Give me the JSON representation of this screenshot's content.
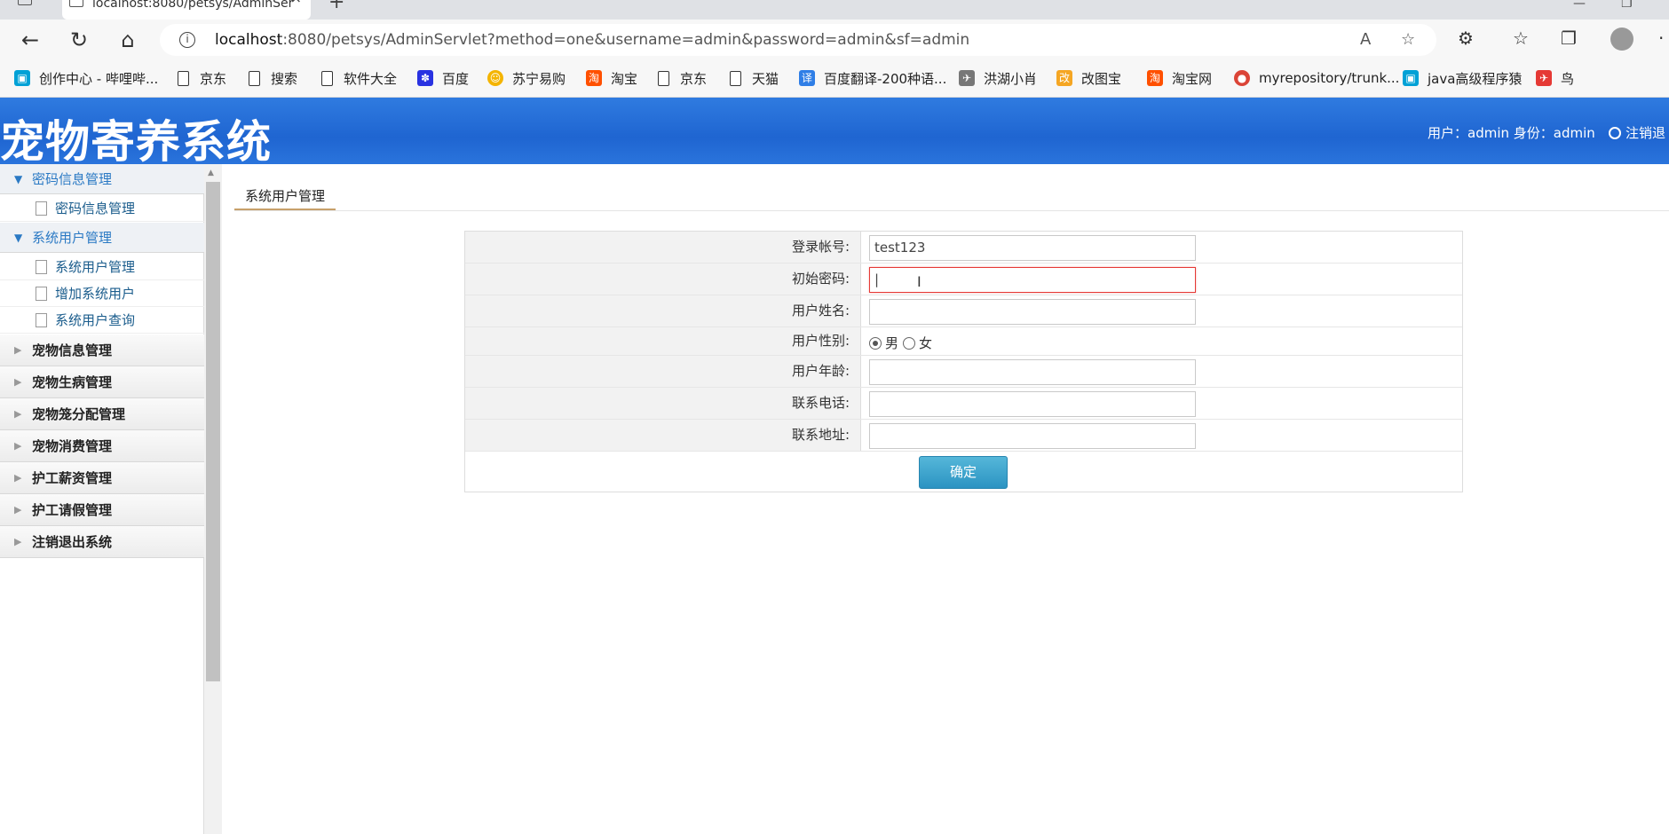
{
  "browser": {
    "tab_title": "localhost:8080/petsys/AdminSer",
    "url_host": "localhost",
    "url_rest": ":8080/petsys/AdminServlet?method=one&username=admin&password=admin&sf=admin"
  },
  "bookmarks": [
    {
      "label": "创作中心 - 哔哩哔...",
      "icon": "bilibili-icon",
      "color": "#00a1d6"
    },
    {
      "label": "京东",
      "icon": "page-icon"
    },
    {
      "label": "搜索",
      "icon": "page-icon"
    },
    {
      "label": "软件大全",
      "icon": "page-icon"
    },
    {
      "label": "百度",
      "icon": "baidu-icon",
      "color": "#2932e1"
    },
    {
      "label": "苏宁易购",
      "icon": "suning-icon",
      "color": "#f4b400"
    },
    {
      "label": "淘宝",
      "icon": "taobao-icon",
      "color": "#ff5000"
    },
    {
      "label": "京东",
      "icon": "page-icon"
    },
    {
      "label": "天猫",
      "icon": "page-icon"
    },
    {
      "label": "百度翻译-200种语...",
      "icon": "fanyi-icon",
      "color": "#2f7ee6"
    },
    {
      "label": "洪湖小肖",
      "icon": "bird-icon",
      "color": "#777777"
    },
    {
      "label": "改图宝",
      "icon": "gaitubao-icon",
      "color": "#f5a623"
    },
    {
      "label": "淘宝网",
      "icon": "taobao-icon",
      "color": "#ff5000"
    },
    {
      "label": "myrepository/trunk...",
      "icon": "chrome-icon",
      "color": "#db4437"
    },
    {
      "label": "java高级程序猿",
      "icon": "bilibili-icon",
      "color": "#00a1d6"
    },
    {
      "label": "鸟",
      "icon": "bird-icon",
      "color": "#e53935"
    }
  ],
  "header": {
    "title": "宠物寄养系统",
    "user_info": "用户：admin 身份：admin",
    "logout": "注销退"
  },
  "sidebar": {
    "groups": [
      {
        "label": "密码信息管理",
        "open": true,
        "items": [
          "密码信息管理"
        ]
      },
      {
        "label": "系统用户管理",
        "open": true,
        "items": [
          "系统用户管理",
          "增加系统用户",
          "系统用户查询"
        ]
      },
      {
        "label": "宠物信息管理",
        "open": false
      },
      {
        "label": "宠物生病管理",
        "open": false
      },
      {
        "label": "宠物笼分配管理",
        "open": false
      },
      {
        "label": "宠物消费管理",
        "open": false
      },
      {
        "label": "护工薪资管理",
        "open": false
      },
      {
        "label": "护工请假管理",
        "open": false
      },
      {
        "label": "注销退出系统",
        "open": false
      }
    ]
  },
  "content": {
    "tab": "系统用户管理",
    "form": {
      "account_label": "登录帐号:",
      "account_value": "test123",
      "password_label": "初始密码:",
      "password_value": "|",
      "name_label": "用户姓名:",
      "name_value": "",
      "gender_label": "用户性别:",
      "gender_male": "男",
      "gender_female": "女",
      "gender_selected": "男",
      "age_label": "用户年龄:",
      "age_value": "",
      "phone_label": "联系电话:",
      "phone_value": "",
      "address_label": "联系地址:",
      "address_value": "",
      "submit_label": "确定"
    }
  }
}
